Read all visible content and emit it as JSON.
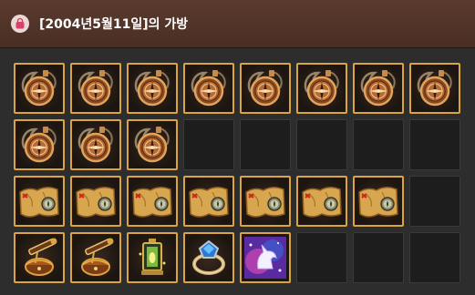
{
  "window": {
    "title": "[2004년5월11일]의 가방",
    "title_icon": "bag-icon",
    "colors": {
      "titlebar": "#4f3328",
      "slot_border_filled": "#d9a441",
      "slot_empty": "#1d1d1d"
    }
  },
  "inventory": {
    "columns": 8,
    "rows": 4,
    "slots": [
      "compass-pocket-watch",
      "compass-pocket-watch",
      "compass-pocket-watch",
      "compass-pocket-watch",
      "compass-pocket-watch",
      "compass-pocket-watch",
      "compass-pocket-watch",
      "compass-pocket-watch",
      "compass-pocket-watch",
      "compass-pocket-watch",
      "compass-pocket-watch",
      "empty",
      "empty",
      "empty",
      "empty",
      "empty",
      "treasure-map-scroll",
      "treasure-map-scroll",
      "treasure-map-scroll",
      "treasure-map-scroll",
      "treasure-map-scroll",
      "treasure-map-scroll",
      "treasure-map-scroll",
      "empty",
      "telescope-chest",
      "telescope-chest",
      "golden-lantern",
      "sapphire-ring",
      "unicorn-card",
      "empty",
      "empty",
      "empty"
    ]
  }
}
